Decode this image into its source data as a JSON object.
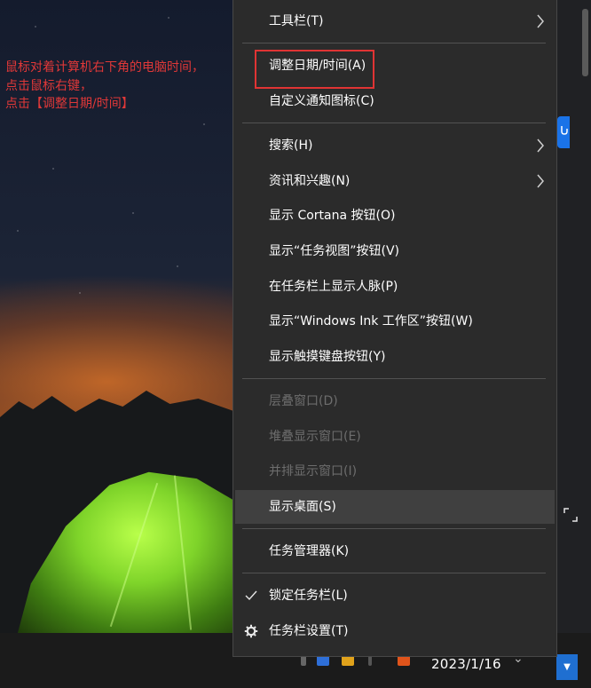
{
  "annotation": {
    "lines": [
      "鼠标对着计算机右下角的电脑时间，",
      "点击鼠标右键，",
      "点击【调整日期/时间】"
    ],
    "color": "#e03838"
  },
  "context_menu": {
    "items": [
      {
        "label": "工具栏(T)",
        "has_submenu": true
      },
      {
        "label": "调整日期/时间(A)",
        "highlighted": true
      },
      {
        "label": "自定义通知图标(C)"
      },
      {
        "label": "搜索(H)",
        "has_submenu": true
      },
      {
        "label": "资讯和兴趣(N)",
        "has_submenu": true
      },
      {
        "label": "显示 Cortana 按钮(O)"
      },
      {
        "label": "显示“任务视图”按钮(V)"
      },
      {
        "label": "在任务栏上显示人脉(P)"
      },
      {
        "label": "显示“Windows Ink 工作区”按钮(W)"
      },
      {
        "label": "显示触摸键盘按钮(Y)"
      },
      {
        "label": "层叠窗口(D)",
        "disabled": true
      },
      {
        "label": "堆叠显示窗口(E)",
        "disabled": true
      },
      {
        "label": "并排显示窗口(I)",
        "disabled": true
      },
      {
        "label": "显示桌面(S)",
        "hover": true
      },
      {
        "label": "任务管理器(K)"
      },
      {
        "label": "锁定任务栏(L)",
        "icon": "checkmark-icon"
      },
      {
        "label": "任务栏设置(T)",
        "icon": "gear-icon"
      }
    ],
    "highlight_color": "#e03434"
  },
  "taskbar": {
    "date": "2023/1/16",
    "dropdown_color": "#1f6fd1"
  }
}
